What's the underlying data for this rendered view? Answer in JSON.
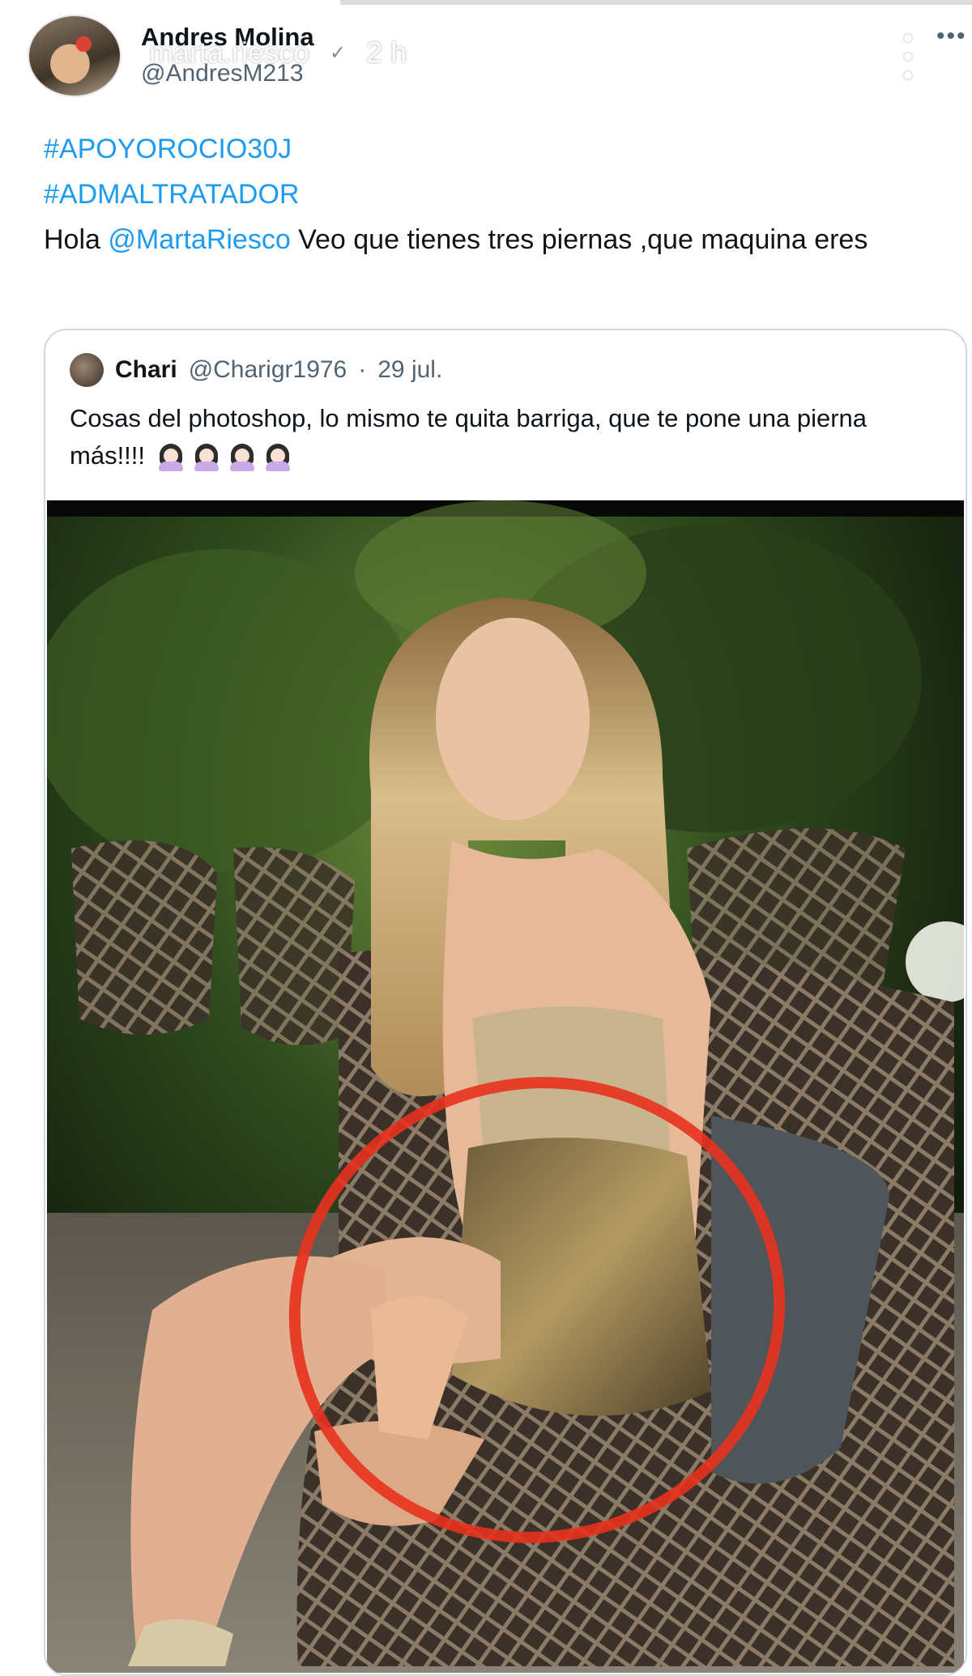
{
  "story": {
    "overlay_username": "marta.riesco",
    "overlay_time": "2 h"
  },
  "post": {
    "author_name": "Andres Molina",
    "author_handle": "@AndresM213",
    "hashtags": [
      "#APOYOROCIO30J",
      "#ADMALTRATADOR"
    ],
    "text_prefix": "Hola",
    "mention": "@MartaRiesco",
    "text_suffix": " Veo que tienes tres piernas ,que maquina eres"
  },
  "quote": {
    "name": "Chari",
    "handle": "@Charigr1976",
    "separator": "·",
    "date": "29 jul.",
    "text": "Cosas del photoshop, lo mismo te quita barriga, que te pone una pierna más!!!!",
    "emoji_count": 4
  },
  "icons": {
    "verified": "verified-badge-icon",
    "kebab": "vertical-dots-icon",
    "more": "more-horizontal-icon"
  },
  "colors": {
    "link": "#1d9bf0",
    "muted": "#536471",
    "highlight_circle": "#e8321e"
  }
}
